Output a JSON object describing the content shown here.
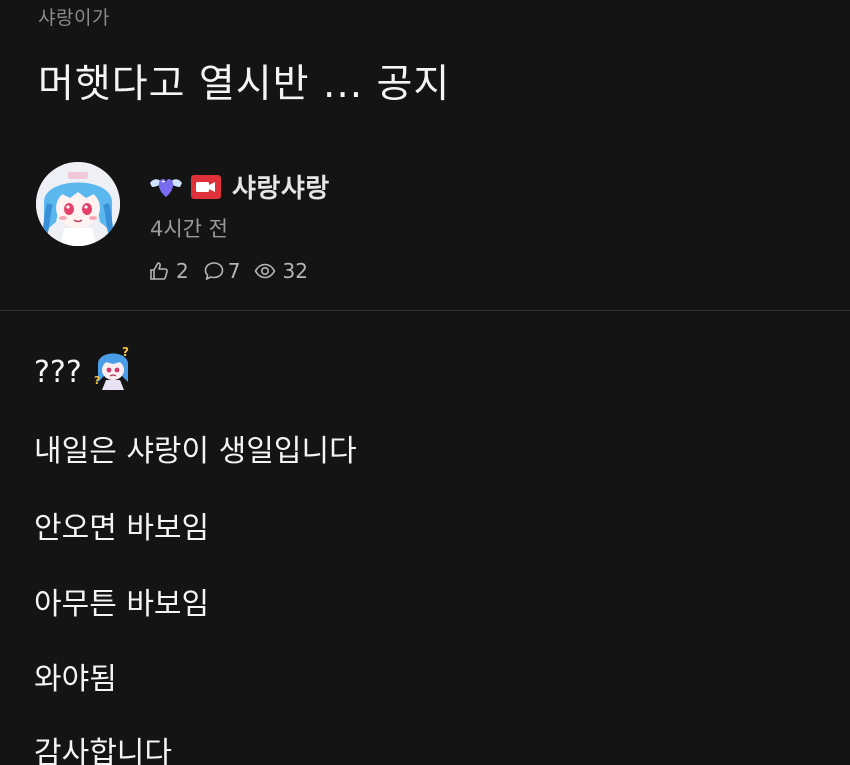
{
  "post": {
    "category": "샤랑이가",
    "title": "머햇다고 열시반 ... 공지"
  },
  "author": {
    "name": "샤랑샤랑",
    "time": "4시간 전",
    "badges": [
      "heart-wings-icon",
      "video-camera-icon"
    ]
  },
  "stats": {
    "likes": "2",
    "comments": "7",
    "views": "32"
  },
  "content": {
    "lines": [
      "???",
      "내일은 샤랑이 생일입니다",
      "안오면 바보임",
      "아무튼 바보임",
      "와야됨",
      "감사합니다"
    ]
  },
  "colors": {
    "background": "#141414",
    "text": "#f4f4f4",
    "muted": "#9a9a9a",
    "badge_red": "#e0313a"
  }
}
